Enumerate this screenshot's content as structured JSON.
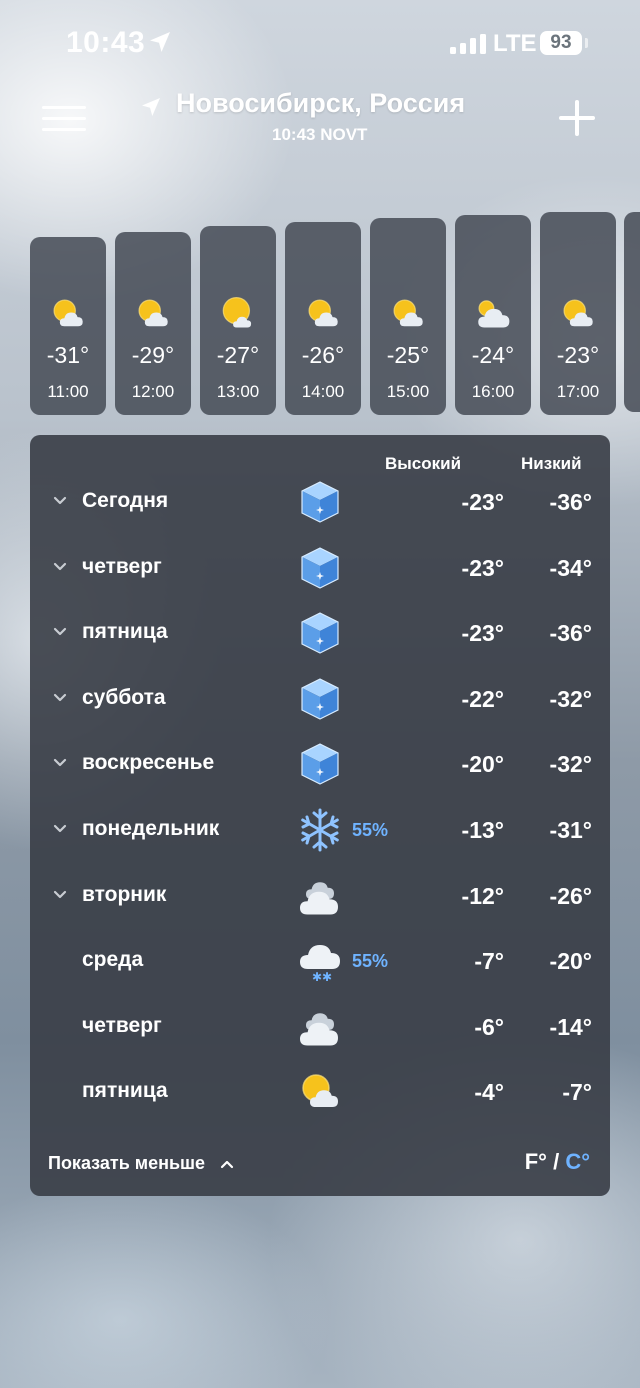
{
  "status_bar": {
    "time": "10:43",
    "network": "LTE",
    "battery": "93",
    "icons": [
      "location-arrow-icon",
      "signal-bars-icon",
      "battery-icon"
    ]
  },
  "header": {
    "city": "Новосибирск, Россия",
    "local_time": "10:43 NOVT",
    "icons": [
      "menu-icon",
      "navigation-icon",
      "plus-icon"
    ]
  },
  "hourly": [
    {
      "time": "11:00",
      "temp": "-31°",
      "icon": "partly-cloudy-sun-icon"
    },
    {
      "time": "12:00",
      "temp": "-29°",
      "icon": "partly-cloudy-sun-icon"
    },
    {
      "time": "13:00",
      "temp": "-27°",
      "icon": "mostly-sunny-icon"
    },
    {
      "time": "14:00",
      "temp": "-26°",
      "icon": "partly-cloudy-sun-icon"
    },
    {
      "time": "15:00",
      "temp": "-25°",
      "icon": "partly-cloudy-sun-icon"
    },
    {
      "time": "16:00",
      "temp": "-24°",
      "icon": "mostly-cloudy-icon"
    },
    {
      "time": "17:00",
      "temp": "-23°",
      "icon": "partly-cloudy-sun-icon"
    }
  ],
  "daily": {
    "high_label": "Высокий",
    "low_label": "Низкий",
    "days": [
      {
        "name": "Сегодня",
        "icon": "ice-cube-icon",
        "precip": "",
        "high": "-23°",
        "low": "-36°",
        "expandable": true
      },
      {
        "name": "четверг",
        "icon": "ice-cube-icon",
        "precip": "",
        "high": "-23°",
        "low": "-34°",
        "expandable": true
      },
      {
        "name": "пятница",
        "icon": "ice-cube-icon",
        "precip": "",
        "high": "-23°",
        "low": "-36°",
        "expandable": true
      },
      {
        "name": "суббота",
        "icon": "ice-cube-icon",
        "precip": "",
        "high": "-22°",
        "low": "-32°",
        "expandable": true
      },
      {
        "name": "воскресенье",
        "icon": "ice-cube-icon",
        "precip": "",
        "high": "-20°",
        "low": "-32°",
        "expandable": true
      },
      {
        "name": "понедельник",
        "icon": "snowflake-icon",
        "precip": "55%",
        "high": "-13°",
        "low": "-31°",
        "expandable": true
      },
      {
        "name": "вторник",
        "icon": "cloud-icon",
        "precip": "",
        "high": "-12°",
        "low": "-26°",
        "expandable": true
      },
      {
        "name": "среда",
        "icon": "snow-cloud-icon",
        "precip": "55%",
        "high": "-7°",
        "low": "-20°",
        "expandable": false
      },
      {
        "name": "четверг",
        "icon": "cloud-icon",
        "precip": "",
        "high": "-6°",
        "low": "-14°",
        "expandable": false
      },
      {
        "name": "пятница",
        "icon": "partly-cloudy-sun-icon",
        "precip": "",
        "high": "-4°",
        "low": "-7°",
        "expandable": false
      }
    ],
    "show_less_label": "Показать меньше",
    "unit_f": "F°",
    "unit_separator": "/",
    "unit_c": "C°"
  },
  "colors": {
    "accent_blue": "#6fb3ff",
    "panel": "#383d46",
    "sun": "#f6c21c",
    "cloud": "#e4e9ef",
    "ice": "#5b9ee8"
  }
}
